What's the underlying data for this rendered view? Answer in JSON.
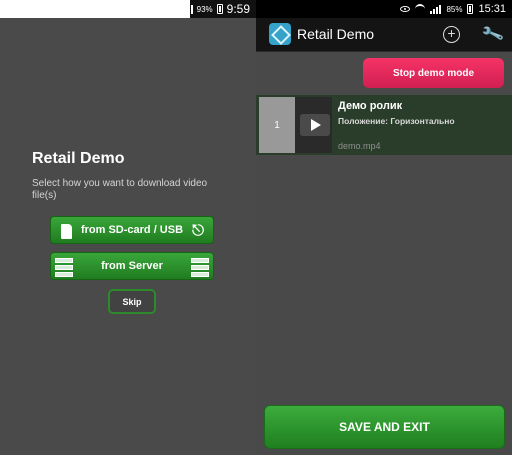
{
  "left_screen": {
    "status_bar": {
      "battery": "93%",
      "time": "9:59"
    },
    "title": "Retail Demo",
    "subtitle": "Select how you want to download video file(s)",
    "buttons": {
      "sd_usb": "from SD-card / USB",
      "server": "from Server",
      "skip": "Skip"
    }
  },
  "right_screen": {
    "status_bar": {
      "battery": "85%",
      "time": "15:31"
    },
    "app_bar": {
      "title": "Retail Demo"
    },
    "stop_button": "Stop demo mode",
    "videos": [
      {
        "index": "1",
        "title": "Демо ролик",
        "orientation": "Положение: Горизонтально",
        "filename": "demo.mp4"
      }
    ],
    "save_button": "SAVE AND EXIT"
  },
  "colors": {
    "background": "#4a4a4a",
    "green_button": "#2e942e",
    "pink_button": "#e8285b",
    "selected_row": "#2a3d2a"
  },
  "icons": [
    "sd-card-icon",
    "usb-icon",
    "server-icon",
    "app-logo-icon",
    "add-icon",
    "wrench-icon",
    "play-icon",
    "wifi-icon",
    "eye-icon",
    "signal-icon",
    "battery-icon"
  ]
}
